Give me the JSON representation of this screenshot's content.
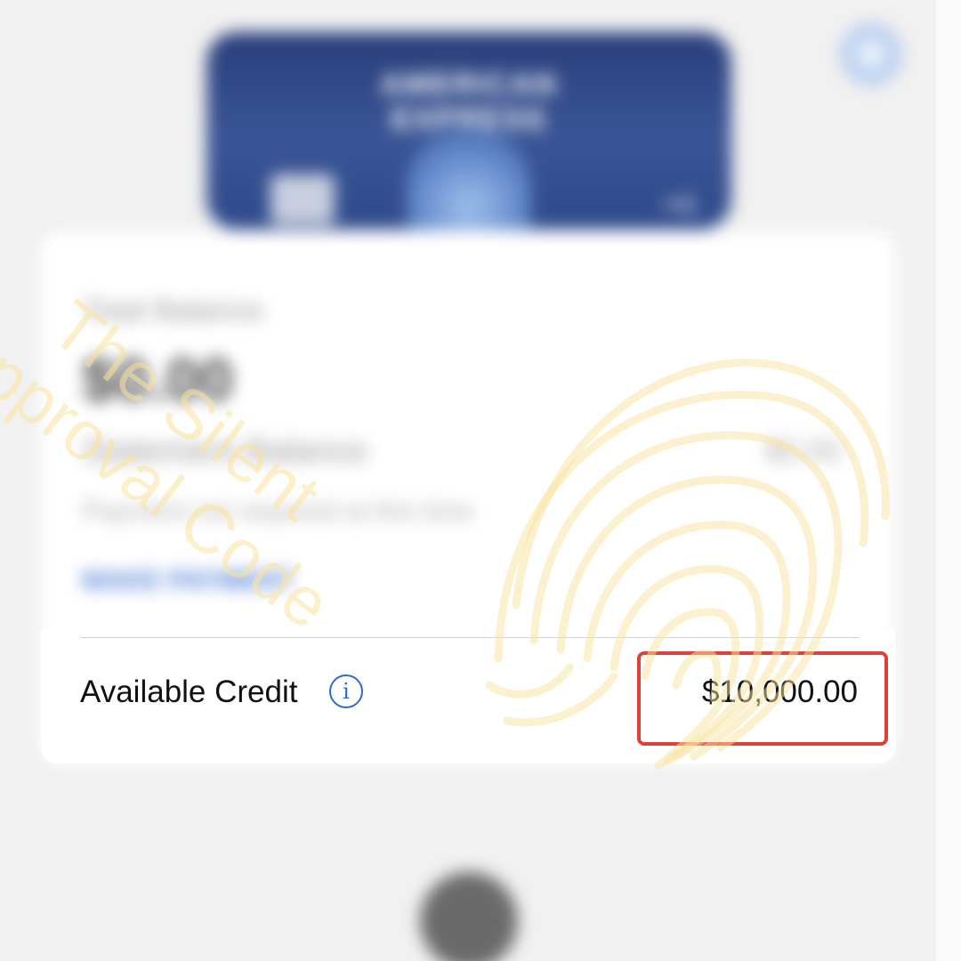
{
  "card": {
    "brand_text": "AMERICAN EXPRESS",
    "last_digits": "••1"
  },
  "account": {
    "total_balance_label": "Total Balance",
    "total_balance_value": "$0.00",
    "statement_balance_label": "Statement Balance",
    "statement_balance_value": "$0.00",
    "payment_note": "Payment not required at this time",
    "make_payment_label": "MAKE PAYMENT"
  },
  "credit": {
    "label": "Available Credit",
    "value": "$10,000.00"
  },
  "watermark": {
    "line1": "The Silent",
    "line2": "Approval Code"
  },
  "colors": {
    "highlight": "#e0403a",
    "info_icon": "#2e6bd0",
    "watermark": "#fae4a0"
  },
  "icons": {
    "info": "info-icon",
    "help": "chat-help-icon",
    "fingerprint": "fingerprint-icon"
  }
}
